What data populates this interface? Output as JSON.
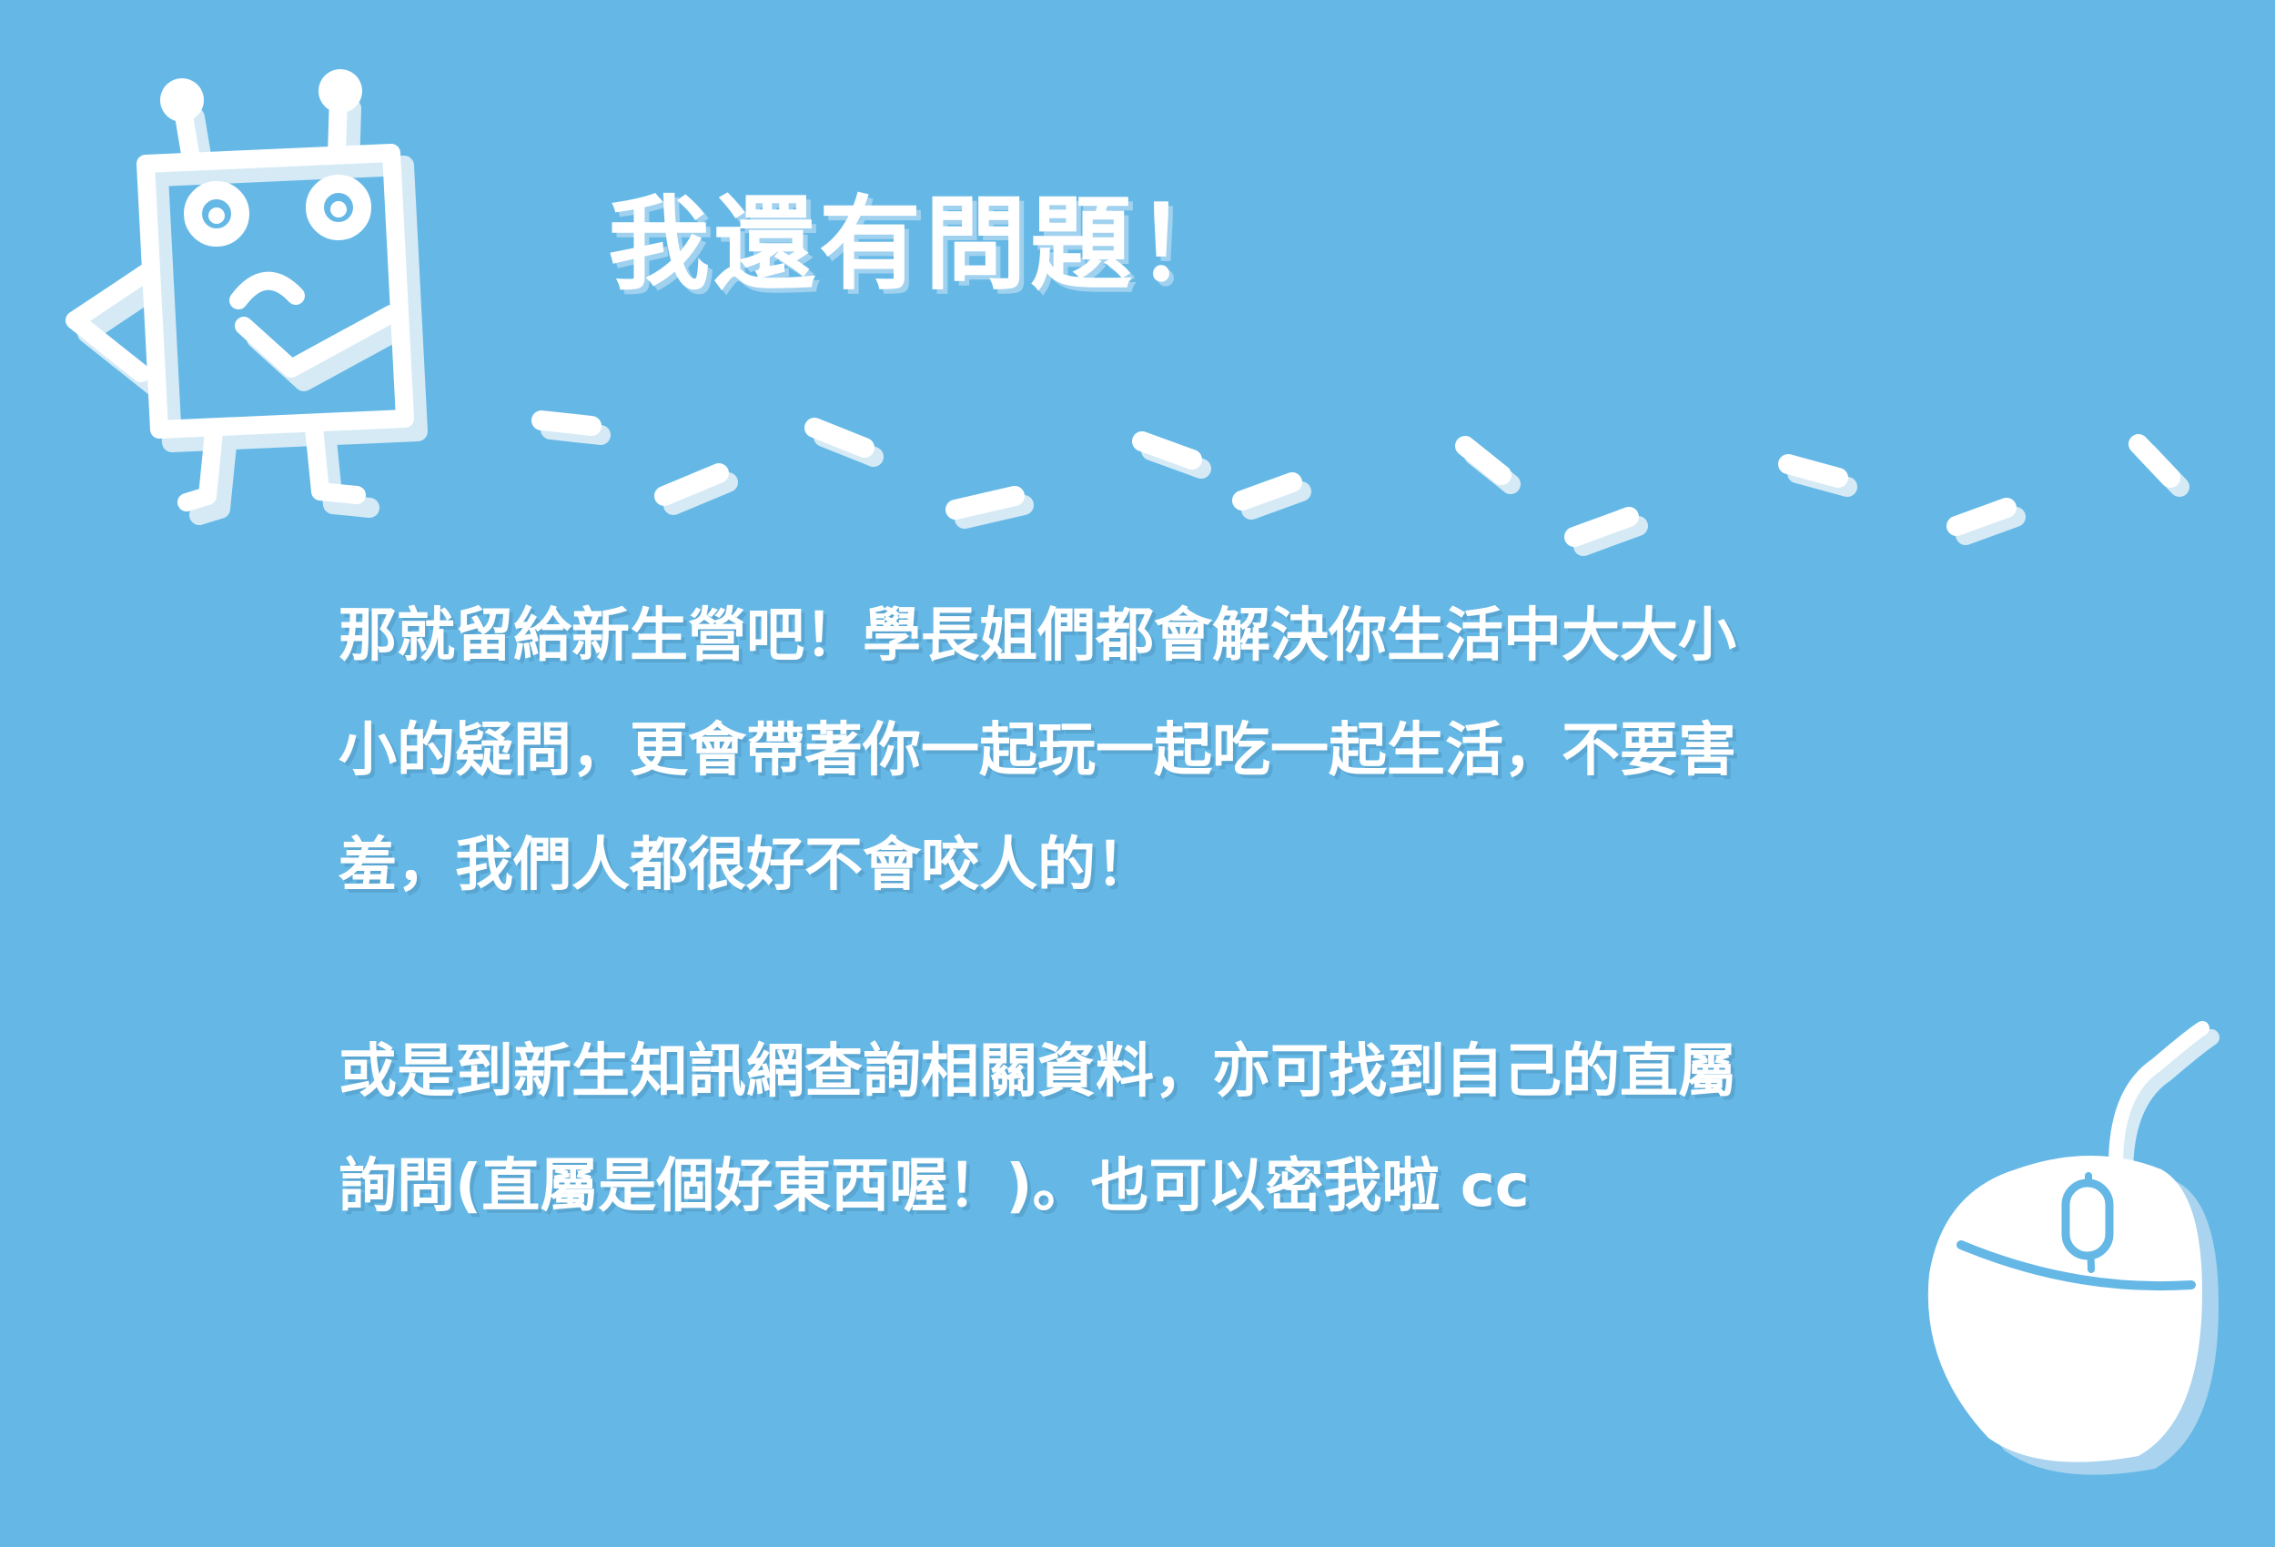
{
  "heading": "我還有問題！",
  "paragraph1": {
    "lines": [
      "那就留給新生營吧！學長姐們都會解決你生活中大大小",
      "小的疑問，更會帶著你一起玩一起吃一起生活，不要害",
      "羞，我們人都很好不會咬人的！"
    ]
  },
  "paragraph2": {
    "lines": [
      "或是到新生知訊網查詢相關資料，亦可找到自己的直屬",
      "詢問(直屬是個好東西喔！)。也可以密我啦 cc"
    ]
  },
  "icons": {
    "mascot": "thinking-robot-icon",
    "mouse": "computer-mouse-icon",
    "trail": "dashed-trail"
  },
  "colors": {
    "background": "#65B8E6",
    "foreground": "#FFFFFF",
    "shadow": "#D6EAF6"
  }
}
